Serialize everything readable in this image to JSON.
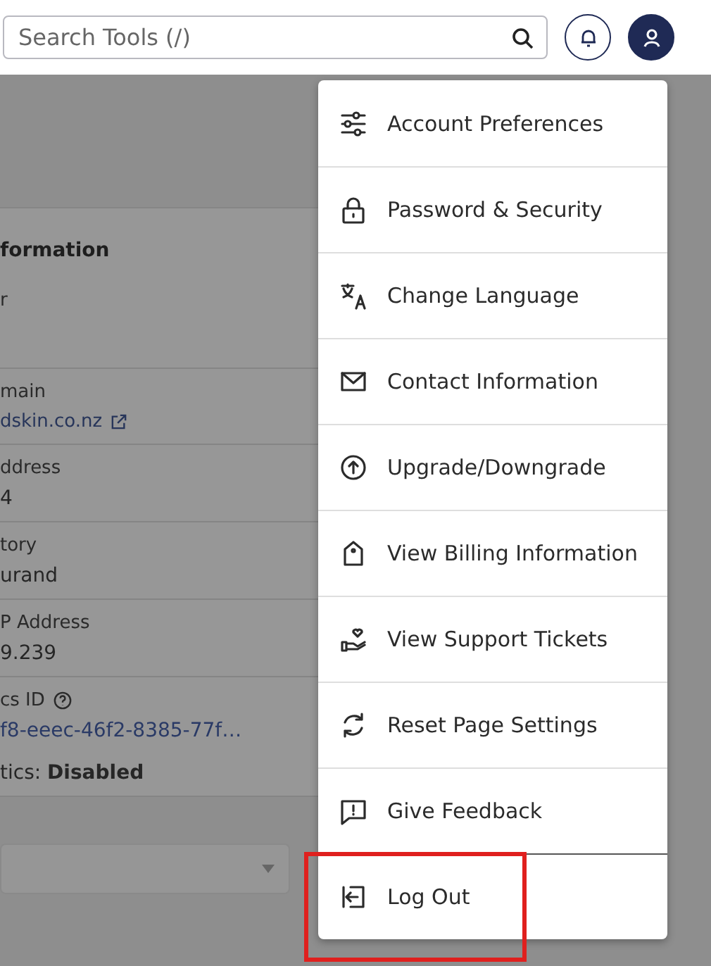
{
  "header": {
    "search": {
      "placeholder": "Search Tools (/)"
    },
    "account_button": {
      "expanded": true
    }
  },
  "info_card": {
    "title": "formation",
    "rows": [
      {
        "kind": "plain",
        "label": "r"
      },
      {
        "kind": "link",
        "label": "main",
        "value": "dskin.co.nz"
      },
      {
        "kind": "plain",
        "label": "ddress",
        "value": "4"
      },
      {
        "kind": "plain",
        "label": "tory",
        "value": "urand"
      },
      {
        "kind": "plain",
        "label": "P Address",
        "value": "9.239"
      },
      {
        "kind": "analytics",
        "label": "cs ID",
        "value": "f8-eeec-46f2-8385-77f…",
        "note": "tics: **Disabled**"
      }
    ],
    "dropdown": {
      "expanded": false
    }
  },
  "account_menu": {
    "items": [
      {
        "label": "Account Preferences",
        "divider_before": false,
        "highlighted": false
      },
      {
        "label": "Password & Security",
        "divider_before": false,
        "highlighted": false
      },
      {
        "label": "Change Language",
        "divider_before": false,
        "highlighted": false
      },
      {
        "label": "Contact Information",
        "divider_before": false,
        "highlighted": false
      },
      {
        "label": "Upgrade/Downgrade",
        "divider_before": false,
        "highlighted": false
      },
      {
        "label": "View Billing Information",
        "divider_before": false,
        "highlighted": false
      },
      {
        "label": "View Support Tickets",
        "divider_before": false,
        "highlighted": false
      },
      {
        "label": "Reset Page Settings",
        "divider_before": false,
        "highlighted": false
      },
      {
        "label": "Give Feedback",
        "divider_before": false,
        "highlighted": false
      },
      {
        "label": "Log Out",
        "divider_before": true,
        "highlighted": true
      }
    ]
  }
}
